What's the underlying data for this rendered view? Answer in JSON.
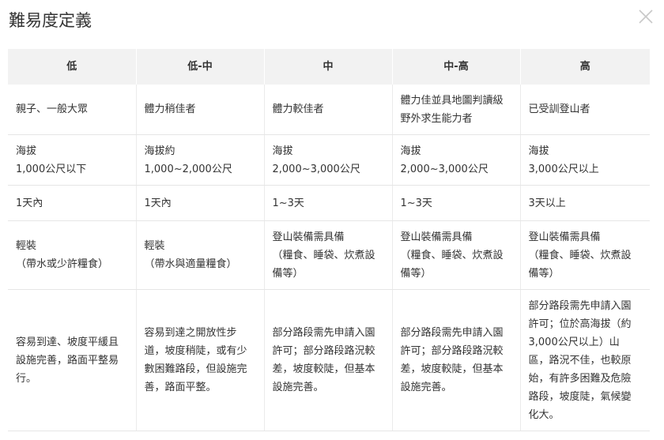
{
  "dialog": {
    "title": "難易度定義"
  },
  "table": {
    "headers": [
      "低",
      "低-中",
      "中",
      "中-高",
      "高"
    ],
    "rows": [
      [
        "親子、一般大眾",
        "體力稍佳者",
        "體力較佳者",
        "體力佳並具地圖判讀級\n野外求生能力者",
        "已受訓登山者"
      ],
      [
        "海拔\n1,000公尺以下",
        "海拔約\n1,000~2,000公尺",
        "海拔\n2,000~3,000公尺",
        "海拔\n2,000~3,000公尺",
        "海拔\n3,000公尺以上"
      ],
      [
        "1天內",
        "1天內",
        "1~3天",
        "1~3天",
        "3天以上"
      ],
      [
        "輕裝\n（帶水或少許糧食）",
        "輕裝\n（帶水與適量糧食）",
        "登山裝備需具備\n（糧食、睡袋、炊煮設\n備等）",
        "登山裝備需具備\n（糧食、睡袋、炊煮設\n備等）",
        "登山裝備需具備\n（糧食、睡袋、炊煮設\n備等）"
      ],
      [
        "容易到達、坡度平緩且\n設施完善，路面平整易\n行。",
        "容易到達之開放性步\n道，坡度稍陡，或有少\n數困難路段，但設施完\n善，路面平整。",
        "部分路段需先申請入園\n許可；部分路段路況較\n差，坡度較陡，但基本\n設施完善。",
        "部分路段需先申請入園\n許可；部分路段路況較\n差，坡度較陡，但基本\n設施完善。",
        "部分路段需先申請入園\n許可；位於高海拔（約\n3,000公尺以上）山\n區，路況不佳，也較原\n始，有許多困難及危險\n路段，坡度陡，氣候變\n化大。"
      ]
    ]
  },
  "icons": {
    "close": "close-icon"
  }
}
